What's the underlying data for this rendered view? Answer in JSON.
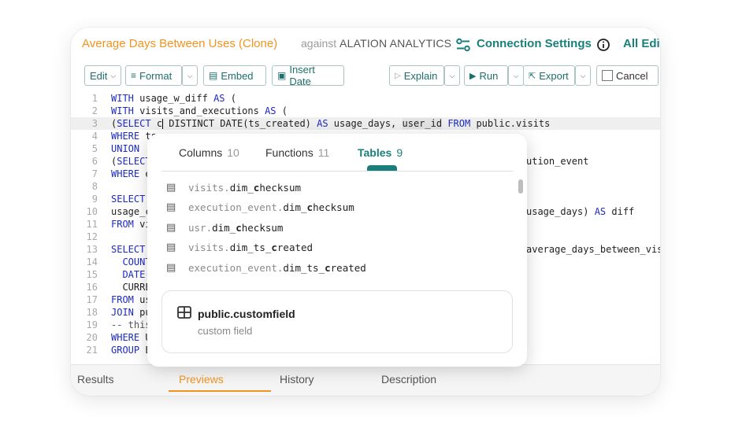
{
  "header": {
    "query_title": "Average Days Between Uses (Clone)",
    "against_label": "against",
    "datasource": "ALATION ANALYTICS",
    "connection_settings": "Connection Settings",
    "all_edits": "All Edi",
    "connection_icon": "sliders-icon",
    "info_icon": "info-circle-icon"
  },
  "toolbar": {
    "edit": "Edit",
    "format": "Format",
    "embed": "Embed",
    "insert_date": "Insert Date",
    "explain": "Explain",
    "run": "Run",
    "export": "Export",
    "cancel": "Cancel"
  },
  "editor": {
    "line_numbers": [
      "1",
      "2",
      "3",
      "4",
      "5",
      "6",
      "7",
      "8",
      "9",
      "10",
      "11",
      "12",
      "13",
      "14",
      "15",
      "16",
      "17",
      "18",
      "19",
      "20",
      "21"
    ],
    "lines": [
      "WITH usage_w_diff AS (",
      "WITH visits_and_executions AS (",
      "(SELECT c DISTINCT DATE(ts_created) AS usage_days, user_id FROM public.visits",
      "WHERE ts",
      "UNION",
      "(SELECT",
      "WHERE e",
      "",
      "SELECT",
      "usage_c",
      "FROM vi",
      "",
      "SELECT",
      "COUNT",
      "DATE(",
      "CURRE",
      "FROM us",
      "JOIN pu",
      "-- this",
      "WHERE U",
      "GROUP E"
    ],
    "right_fragments": [
      "ution_event",
      "usage_days) AS diff",
      "average_days_between_visi"
    ]
  },
  "autocomplete": {
    "tabs": [
      {
        "label": "Columns",
        "count": "10"
      },
      {
        "label": "Functions",
        "count": "11"
      },
      {
        "label": "Tables",
        "count": "9"
      }
    ],
    "active_tab": "Tables",
    "items": [
      {
        "table": "visits.",
        "column": "dim_checksum",
        "icon": "database-icon"
      },
      {
        "table": "execution_event.",
        "column": "dim_checksum",
        "icon": "database-icon"
      },
      {
        "table": "usr.",
        "column": "dim_checksum",
        "icon": "database-icon"
      },
      {
        "table": "visits.",
        "column": "dim_ts_created",
        "icon": "database-icon"
      },
      {
        "table": "execution_event.",
        "column": "dim_ts_created",
        "icon": "database-icon"
      }
    ],
    "detail": {
      "name": "public.customfield",
      "description": "custom field",
      "icon": "table-grid-icon"
    }
  },
  "results_tabs": [
    "Results",
    "Previews",
    "History",
    "Description"
  ],
  "active_results_tab": "Previews",
  "colors": {
    "accent_orange": "#f0941f",
    "accent_teal": "#1a7f7a",
    "keyword_blue": "#1d2ac2"
  }
}
